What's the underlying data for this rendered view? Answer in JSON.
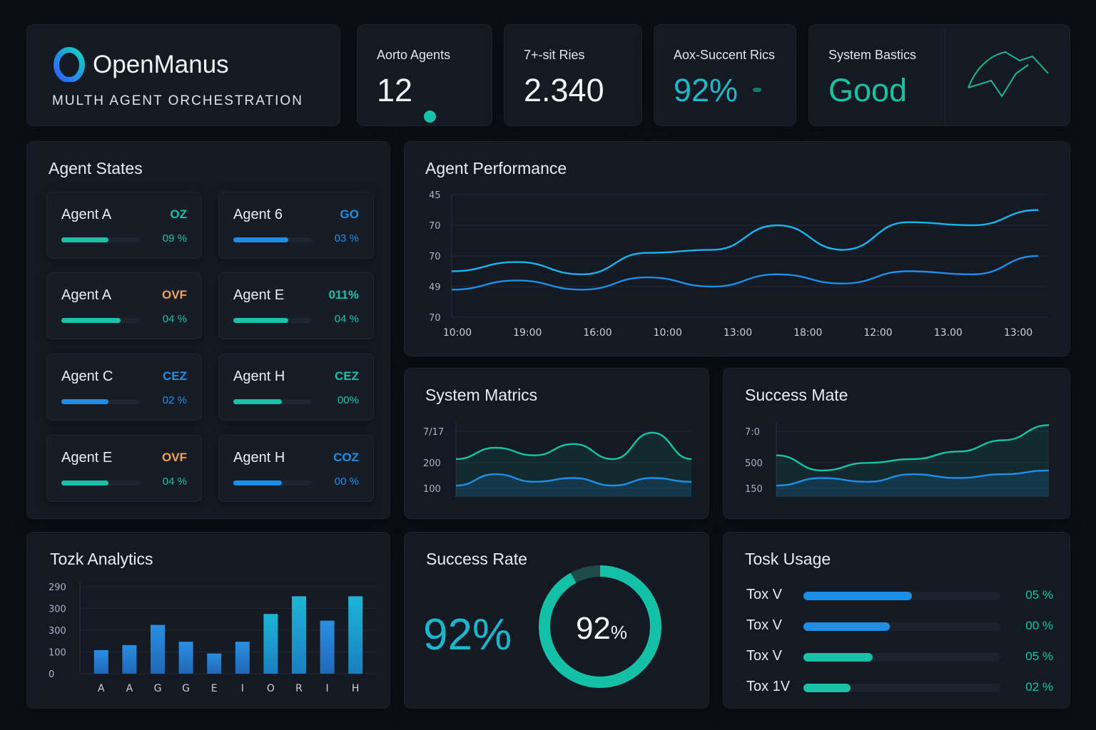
{
  "brand": {
    "name": "OpenManus",
    "subtitle": "MULTH AGENT ORCHESTRATION"
  },
  "stats": [
    {
      "label": "Aorto Agents",
      "value": "12"
    },
    {
      "label": "7+-sit Ries",
      "value": "2.340"
    },
    {
      "label": "Aox-Succent Rics",
      "value": "92%"
    },
    {
      "label": "System Bastics",
      "value": "Good"
    }
  ],
  "colors": {
    "teal": "#18c1a8",
    "blue": "#1e8fe8",
    "orange": "#f0a35a",
    "cyan": "#19c0e0"
  },
  "agent_states": {
    "title": "Agent States",
    "agents": [
      {
        "name": "Agent A",
        "code": "OZ",
        "pct": "09 %",
        "level": 0.6,
        "color": "teal"
      },
      {
        "name": "Agent 6",
        "code": "GO",
        "pct": "03 %",
        "level": 0.7,
        "color": "blue"
      },
      {
        "name": "Agent A",
        "code": "OVF",
        "pct": "04 %",
        "level": 0.75,
        "color": "teal"
      },
      {
        "name": "Agent E",
        "code": "011%",
        "pct": "04 %",
        "level": 0.7,
        "color": "teal"
      },
      {
        "name": "Agent C",
        "code": "CEZ",
        "pct": "02 %",
        "level": 0.6,
        "color": "blue"
      },
      {
        "name": "Agent H",
        "code": "CEZ",
        "pct": "00%",
        "level": 0.62,
        "color": "teal"
      },
      {
        "name": "Agent E",
        "code": "OVF",
        "pct": "04 %",
        "level": 0.6,
        "color": "teal"
      },
      {
        "name": "Agent H",
        "code": "COZ",
        "pct": "00 %",
        "level": 0.62,
        "color": "blue"
      }
    ]
  },
  "performance": {
    "title": "Agent Performance",
    "y_ticks": [
      "45",
      "70",
      "70",
      "49",
      "70"
    ],
    "x_ticks": [
      "10:00",
      "19:00",
      "16:00",
      "10:00",
      "13:00",
      "18:00",
      "12:00",
      "13.00",
      "13:00"
    ]
  },
  "system_metrics": {
    "title": "System Matrics",
    "y_ticks": [
      "7/17",
      "200",
      "100"
    ]
  },
  "success_mate": {
    "title": "Success Mate",
    "y_ticks": [
      "7:0",
      "500",
      "150"
    ]
  },
  "task_analytics": {
    "title": "Tozk Analytics",
    "y_ticks": [
      "290",
      "300",
      "300",
      "100",
      "0"
    ],
    "x_ticks": [
      "A",
      "A",
      "G",
      "G",
      "E",
      "I",
      "O",
      "R",
      "I",
      "H"
    ]
  },
  "success_rate": {
    "title": "Success Rate",
    "value_big": "92%",
    "ring_number": "92",
    "ring_unit": "%",
    "fraction": 0.92
  },
  "task_usage": {
    "title": "Tosk Usage",
    "rows": [
      {
        "label": "Tox V",
        "pct": "05 %",
        "level": 0.55,
        "color": "blue"
      },
      {
        "label": "Tox V",
        "pct": "00 %",
        "level": 0.44,
        "color": "blue"
      },
      {
        "label": "Tox V",
        "pct": "05 %",
        "level": 0.35,
        "color": "teal"
      },
      {
        "label": "Tox 1V",
        "pct": "02 %",
        "level": 0.24,
        "color": "teal"
      }
    ]
  },
  "chart_data": [
    {
      "type": "line",
      "title": "Agent Performance",
      "x": [
        "10:00",
        "19:00",
        "16:00",
        "10:00",
        "13:00",
        "18:00",
        "12:00",
        "13.00",
        "13:00"
      ],
      "series": [
        {
          "values": [
            55,
            58,
            54,
            61,
            62,
            70,
            62,
            71,
            70,
            75
          ]
        },
        {
          "values": [
            49,
            52,
            49,
            53,
            50,
            54,
            51,
            55,
            54,
            60
          ]
        }
      ]
    },
    {
      "type": "area",
      "title": "System Matrics",
      "series": [
        {
          "values": [
            0.5,
            0.65,
            0.55,
            0.7,
            0.5,
            0.85,
            0.5
          ]
        },
        {
          "values": [
            0.15,
            0.3,
            0.2,
            0.25,
            0.15,
            0.25,
            0.2
          ]
        }
      ]
    },
    {
      "type": "area",
      "title": "Success Mate",
      "series": [
        {
          "values": [
            0.55,
            0.35,
            0.45,
            0.5,
            0.6,
            0.75,
            0.95
          ]
        },
        {
          "values": [
            0.15,
            0.25,
            0.2,
            0.3,
            0.25,
            0.3,
            0.35
          ]
        }
      ]
    },
    {
      "type": "bar",
      "title": "Tozk Analytics",
      "categories": [
        "A",
        "A",
        "G",
        "G",
        "E",
        "I",
        "O",
        "R",
        "I",
        "H"
      ],
      "values": [
        0.28,
        0.34,
        0.58,
        0.38,
        0.24,
        0.38,
        0.71,
        0.92,
        0.63,
        0.92
      ]
    }
  ]
}
